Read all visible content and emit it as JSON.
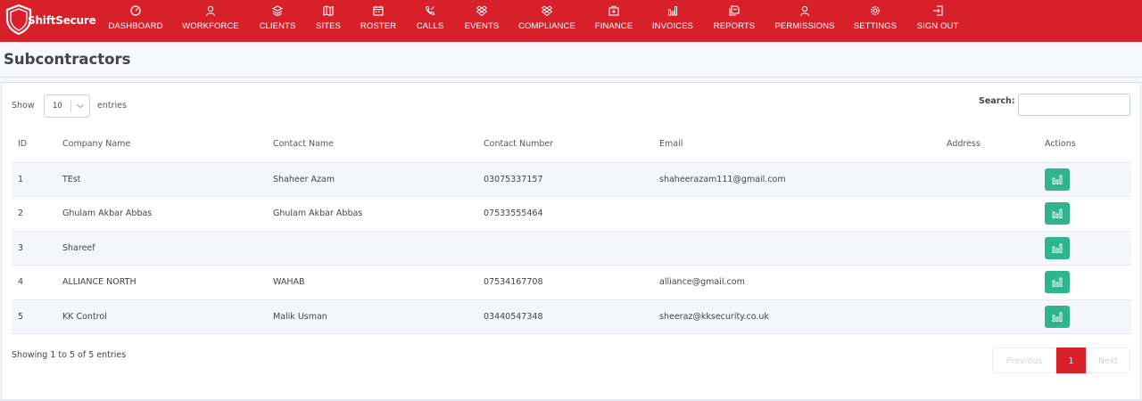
{
  "brand": {
    "name": "ShiftSecure",
    "color": "#d8202a"
  },
  "nav": [
    {
      "label": "DASHBOARD",
      "icon": "gauge-icon"
    },
    {
      "label": "WORKFORCE",
      "icon": "users-icon"
    },
    {
      "label": "CLIENTS",
      "icon": "layers-icon"
    },
    {
      "label": "SITES",
      "icon": "map-icon"
    },
    {
      "label": "ROSTER",
      "icon": "calendar-icon"
    },
    {
      "label": "CALLS",
      "icon": "phone-icon"
    },
    {
      "label": "EVENTS",
      "icon": "dropbox-icon"
    },
    {
      "label": "COMPLIANCE",
      "icon": "dropbox-icon"
    },
    {
      "label": "FINANCE",
      "icon": "briefcase-icon"
    },
    {
      "label": "INVOICES",
      "icon": "bar-chart-icon"
    },
    {
      "label": "REPORTS",
      "icon": "copy-icon"
    },
    {
      "label": "PERMISSIONS",
      "icon": "user-icon"
    },
    {
      "label": "SETTINGS",
      "icon": "gear-icon"
    },
    {
      "label": "SIGN OUT",
      "icon": "sign-out-icon"
    }
  ],
  "page": {
    "title": "Subcontractors"
  },
  "table_controls": {
    "show_label": "Show",
    "entries_label": "entries",
    "page_length": "10",
    "search_label": "Search:",
    "search_value": ""
  },
  "table": {
    "columns": [
      "ID",
      "Company Name",
      "Contact Name",
      "Contact Number",
      "Email",
      "Address",
      "Actions"
    ],
    "rows": [
      {
        "id": "1",
        "company": "TEst",
        "contact": "Shaheer Azam",
        "number": "03075337157",
        "email": "shaheerazam111@gmail.com",
        "address": ""
      },
      {
        "id": "2",
        "company": "Ghulam Akbar Abbas",
        "contact": "Ghulam Akbar Abbas",
        "number": "07533555464",
        "email": "",
        "address": ""
      },
      {
        "id": "3",
        "company": "Shareef",
        "contact": "",
        "number": "",
        "email": "",
        "address": ""
      },
      {
        "id": "4",
        "company": "ALLIANCE NORTH",
        "contact": "WAHAB",
        "number": "07534167708",
        "email": "alliance@gmail.com",
        "address": ""
      },
      {
        "id": "5",
        "company": "KK Control",
        "contact": "Malik Usman",
        "number": "03440547348",
        "email": "sheeraz@kksecurity.co.uk",
        "address": ""
      }
    ],
    "action_icon": "bar-chart-icon",
    "action_color": "#2fb58e"
  },
  "footer": {
    "info": "Showing 1 to 5 of 5 entries",
    "prev_label": "Previous",
    "current_page": "1",
    "next_label": "Next"
  }
}
